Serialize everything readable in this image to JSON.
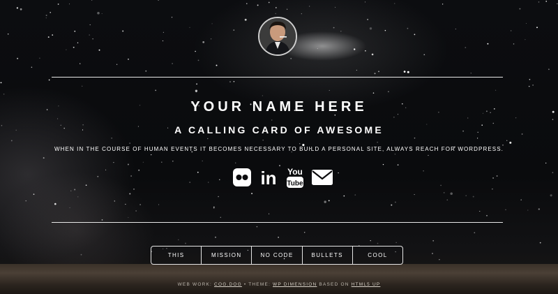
{
  "header": {
    "avatar_alt": "avatar photo"
  },
  "intro": {
    "name": "YOUR NAME HERE",
    "tagline": "A CALLING CARD OF AWESOME",
    "blurb": "WHEN IN THE COURSE OF HUMAN EVENTS IT BECOMES NECESSARY TO BUILD A PERSONAL SITE, ALWAYS REACH FOR WORDPRESS."
  },
  "social": [
    {
      "icon": "flickr-icon"
    },
    {
      "icon": "linkedin-icon",
      "text": "in"
    },
    {
      "icon": "youtube-icon",
      "text_top": "You",
      "text_bottom": "Tube"
    },
    {
      "icon": "email-icon"
    }
  ],
  "nav": {
    "items": [
      "THIS",
      "MISSION",
      "NO CODE",
      "BULLETS",
      "COOL"
    ]
  },
  "footer": {
    "prefix": "WEB WORK: ",
    "link1": "COG.DOG",
    "middle": " • THEME: ",
    "link2": "WP DIMENSION",
    "suffix": " BASED ON ",
    "link3": "HTML5 UP"
  },
  "colors": {
    "text": "#ffffff",
    "rule": "#e8e8e8",
    "background": "#07080a"
  }
}
